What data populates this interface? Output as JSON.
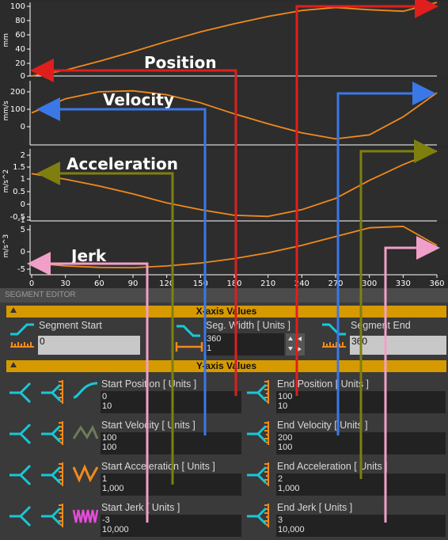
{
  "charts": {
    "x_ticks": [
      "0",
      "30",
      "60",
      "90",
      "120",
      "150",
      "180",
      "210",
      "240",
      "270",
      "300",
      "330",
      "360"
    ],
    "panels": [
      {
        "title": "Position",
        "unit": "mm",
        "y_ticks": [
          "100",
          "80",
          "60",
          "40",
          "20",
          "0"
        ]
      },
      {
        "title": "Velocity",
        "unit": "mm/s",
        "y_ticks": [
          "200",
          "100",
          "0"
        ]
      },
      {
        "title": "Acceleration",
        "unit": "m/s^2",
        "y_ticks": [
          "2",
          "1.5",
          "1",
          "0.5",
          "0",
          "-0.5",
          "-1"
        ]
      },
      {
        "title": "Jerk",
        "unit": "m/s^3",
        "y_ticks": [
          "5",
          "0",
          "-5"
        ]
      }
    ]
  },
  "chart_data": [
    {
      "type": "line",
      "title": "Position",
      "ylabel": "mm",
      "xlim": [
        0,
        360
      ],
      "ylim": [
        0,
        100
      ],
      "series": [
        {
          "x": [
            0,
            30,
            60,
            90,
            120,
            150,
            180,
            210,
            240,
            270,
            300,
            330,
            360
          ],
          "y": [
            0,
            8,
            20,
            33,
            47,
            60,
            71,
            81,
            89,
            93,
            90,
            88,
            100
          ]
        }
      ]
    },
    {
      "type": "line",
      "title": "Velocity",
      "ylabel": "mm/s",
      "xlim": [
        0,
        360
      ],
      "ylim": [
        -60,
        260
      ],
      "series": [
        {
          "x": [
            0,
            30,
            60,
            90,
            120,
            150,
            180,
            210,
            240,
            270,
            300,
            330,
            360
          ],
          "y": [
            100,
            170,
            205,
            210,
            190,
            150,
            95,
            45,
            0,
            -30,
            -10,
            80,
            200
          ]
        }
      ]
    },
    {
      "type": "line",
      "title": "Acceleration",
      "ylabel": "m/s^2",
      "xlim": [
        0,
        360
      ],
      "ylim": [
        -1.1,
        2.1
      ],
      "series": [
        {
          "x": [
            0,
            30,
            60,
            90,
            120,
            150,
            180,
            210,
            240,
            270,
            300,
            330,
            360
          ],
          "y": [
            1,
            0.75,
            0.45,
            0.1,
            -0.3,
            -0.6,
            -0.85,
            -0.9,
            -0.6,
            -0.1,
            0.7,
            1.4,
            2
          ]
        }
      ]
    },
    {
      "type": "line",
      "title": "Jerk",
      "ylabel": "m/s^3",
      "xlim": [
        0,
        360
      ],
      "ylim": [
        -7,
        10
      ],
      "series": [
        {
          "x": [
            0,
            30,
            60,
            90,
            120,
            150,
            180,
            210,
            240,
            270,
            300,
            330,
            360
          ],
          "y": [
            -3,
            -4,
            -4.5,
            -4.6,
            -4,
            -3,
            -1.5,
            0.5,
            3,
            6,
            9,
            9.5,
            3
          ]
        }
      ]
    }
  ],
  "editor": {
    "header": "SEGMENT EDITOR",
    "xaxis": {
      "bar_label": "X-axis Values",
      "segment_start_label": "Segment Start",
      "segment_start_value": "0",
      "seg_width_label": "Seg. Width [ Units ]",
      "seg_width_value": "360",
      "seg_width_sub": "1",
      "segment_end_label": "Segment End",
      "segment_end_value": "360"
    },
    "yaxis": {
      "bar_label": "Y-axis Values",
      "rows": [
        {
          "start_label": "Start Position [ Units ]",
          "start_v1": "0",
          "start_v2": "10",
          "end_label": "End Position [ Units ]",
          "end_v1": "100",
          "end_v2": "10"
        },
        {
          "start_label": "Start Velocity [ Units ]",
          "start_v1": "100",
          "start_v2": "100",
          "end_label": "End Velocity [ Units ]",
          "end_v1": "200",
          "end_v2": "100"
        },
        {
          "start_label": "Start Acceleration [ Units ]",
          "start_v1": "1",
          "start_v2": "1,000",
          "end_label": "End Acceleration [ Units ]",
          "end_v1": "2",
          "end_v2": "1,000"
        },
        {
          "start_label": "Start Jerk [ Units ]",
          "start_v1": "-3",
          "start_v2": "10,000",
          "end_label": "End Jerk [ Units ]",
          "end_v1": "3",
          "end_v2": "10,000"
        }
      ]
    }
  },
  "colors": {
    "curve": "#f08a1c",
    "position": "#e01e1e",
    "velocity": "#3a78e8",
    "acceleration": "#7f7f10",
    "jerk": "#f0a0c8",
    "accent": "#d69a00",
    "icon_cyan": "#18c8d8",
    "icon_orange": "#f08a1c"
  }
}
